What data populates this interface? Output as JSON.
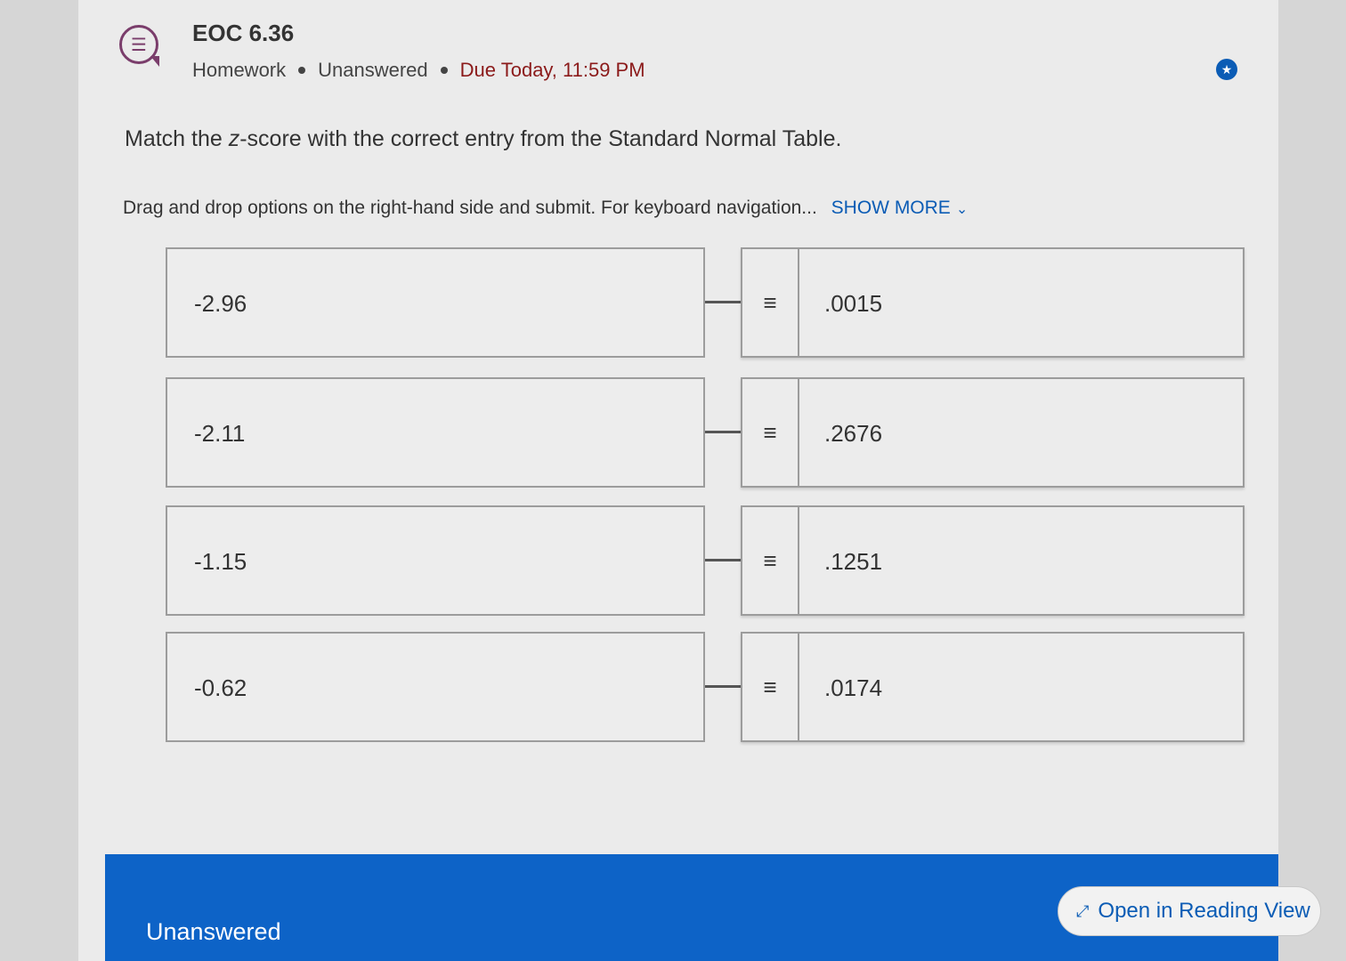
{
  "header": {
    "title": "EOC 6.36",
    "category": "Homework",
    "status": "Unanswered",
    "due": "Due Today, 11:59 PM",
    "icon": "list-chat-icon"
  },
  "question": {
    "prefix": "Match the ",
    "z": "z",
    "suffix": "-score with the correct entry from the Standard Normal Table."
  },
  "instructions": {
    "text": "Drag and drop options on the right-hand side and submit. For keyboard navigation...",
    "show_more": "SHOW MORE"
  },
  "pairs": [
    {
      "left": "-2.96",
      "right": ".0015"
    },
    {
      "left": "-2.11",
      "right": ".2676"
    },
    {
      "left": "-1.15",
      "right": ".1251"
    },
    {
      "left": "-0.62",
      "right": ".0174"
    }
  ],
  "footer": {
    "status": "Unanswered",
    "reading_view": "Open in Reading View"
  },
  "colors": {
    "accent": "#0b5cb5",
    "footer_bg": "#0d63c7",
    "due": "#8b1a1a"
  }
}
